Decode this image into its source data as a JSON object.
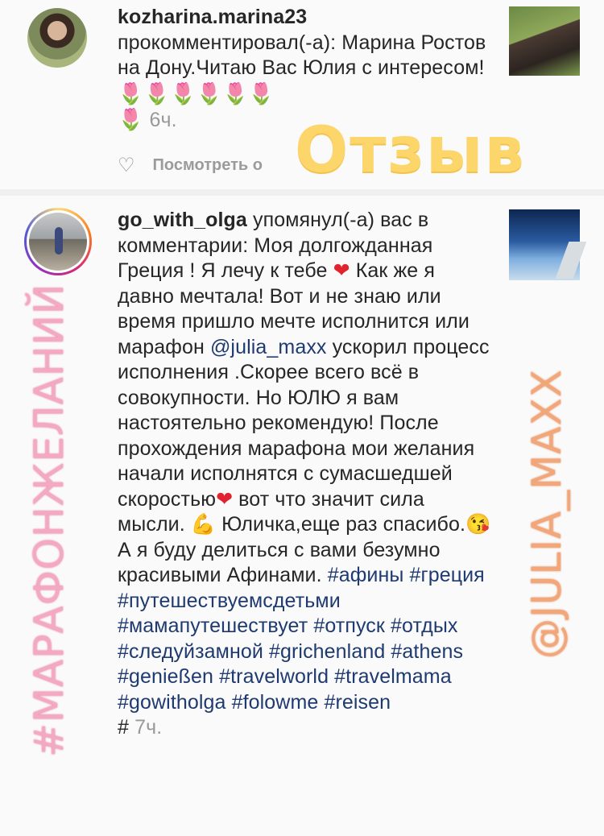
{
  "notification1": {
    "username": "kozharina.marina23",
    "action": "прокомментировал(-а): Марина Ростов на Дону.Читаю Вас Юлия с интересом!",
    "time": "6ч.",
    "view_link": "Посмотреть о"
  },
  "notification2": {
    "username": "go_with_olga",
    "action": " упомянул(-а) вас в комментарии: Моя долгожданная Греция ! Я лечу к тебе ",
    "text_a": " Как же я давно мечтала! Вот и не знаю или время пришло мечте исполнится или марафон ",
    "mention": "@julia_maxx",
    "text_b": "  ускорил  процесс исполнения .Скорее всего всё в совокупности. Но ЮЛЮ я вам настоятельно рекомендую! После прохождения марафона мои желания начали исполнятся с сумасшедшей скоростью",
    "text_c": " вот что значит сила мысли. ",
    "text_d": " Юличка,еще раз спасибо.",
    "text_e": " А я буду делиться с вами безумно красивыми Афинами. ",
    "hashtags": [
      "#афины",
      "#греция",
      "#путешествуемсдетьми",
      "#мамапутешествует",
      "#отпуск",
      "#отдых",
      "#следуйзамной",
      "#grichenland",
      "#athens",
      "#genießen",
      "#travelworld",
      "#travelmama",
      "#gowitholga",
      "#folowme",
      "#reisen",
      "#"
    ],
    "time": "7ч."
  },
  "overlays": {
    "stamp": "Отзыв",
    "left_vertical": "#МАРАФОНЖЕЛАНИЙ",
    "right_vertical": "@JULIA_MAXX"
  },
  "icons": {
    "tulip": "tulip-emoji",
    "heart": "red-heart-emoji",
    "muscle": "flexed-biceps-emoji",
    "kiss": "face-blowing-kiss-emoji",
    "like": "heart-outline-icon"
  },
  "colors": {
    "mention": "#1e3a70",
    "muted": "#999999",
    "stamp": "#fcd66a",
    "left_vertical": "#f4a9c2",
    "right_vertical": "#f2a77a"
  }
}
